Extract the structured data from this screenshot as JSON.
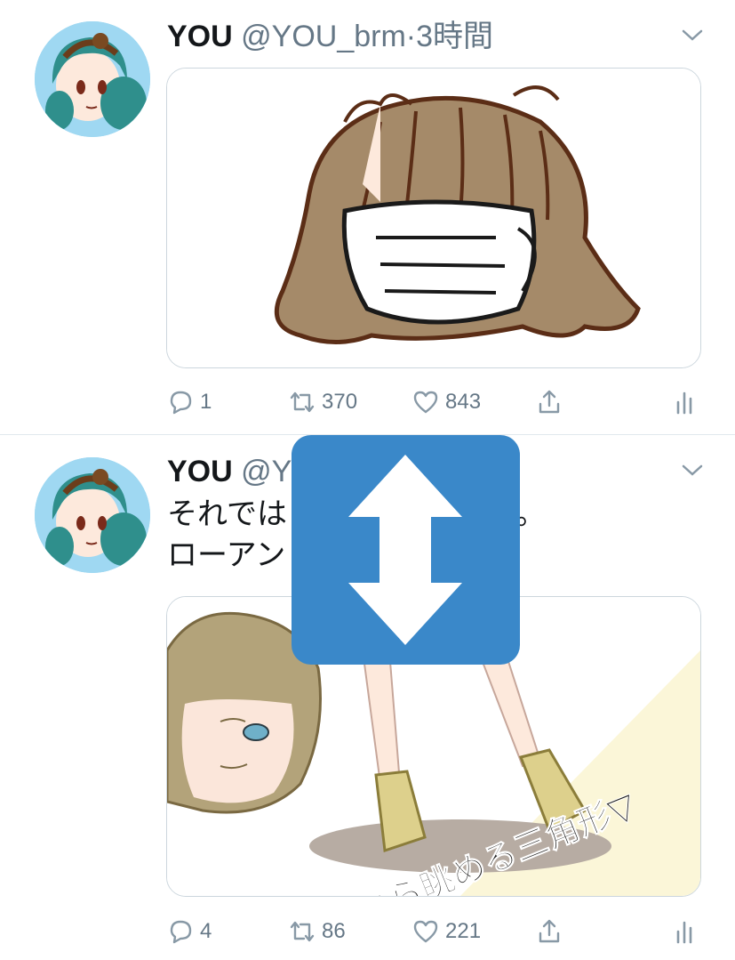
{
  "tweets": [
    {
      "name": "YOU",
      "handle": "@YOU_brm",
      "separator": "·",
      "time": "3時間",
      "text_lines": [],
      "actions": {
        "reply": "1",
        "retweet": "370",
        "like": "843"
      }
    },
    {
      "name": "YOU",
      "handle": "@Y",
      "separator": "",
      "time": "",
      "text_lines": [
        "それでは",
        "ローアン"
      ],
      "text_trailing": "。",
      "media_caption": "下から眺める三角形▽",
      "actions": {
        "reply": "4",
        "retweet": "86",
        "like": "221"
      }
    }
  ],
  "icons": {
    "menu": "chevron-down-icon",
    "reply": "reply-bubble-icon",
    "retweet": "retweet-icon",
    "like": "heart-icon",
    "share": "share-icon",
    "stats": "stats-bars-icon",
    "scroll": "up-down-arrow-icon"
  },
  "colors": {
    "accent": "#3a88c9",
    "muted": "#657786",
    "border": "#ccd6dd",
    "text": "#14171a"
  }
}
